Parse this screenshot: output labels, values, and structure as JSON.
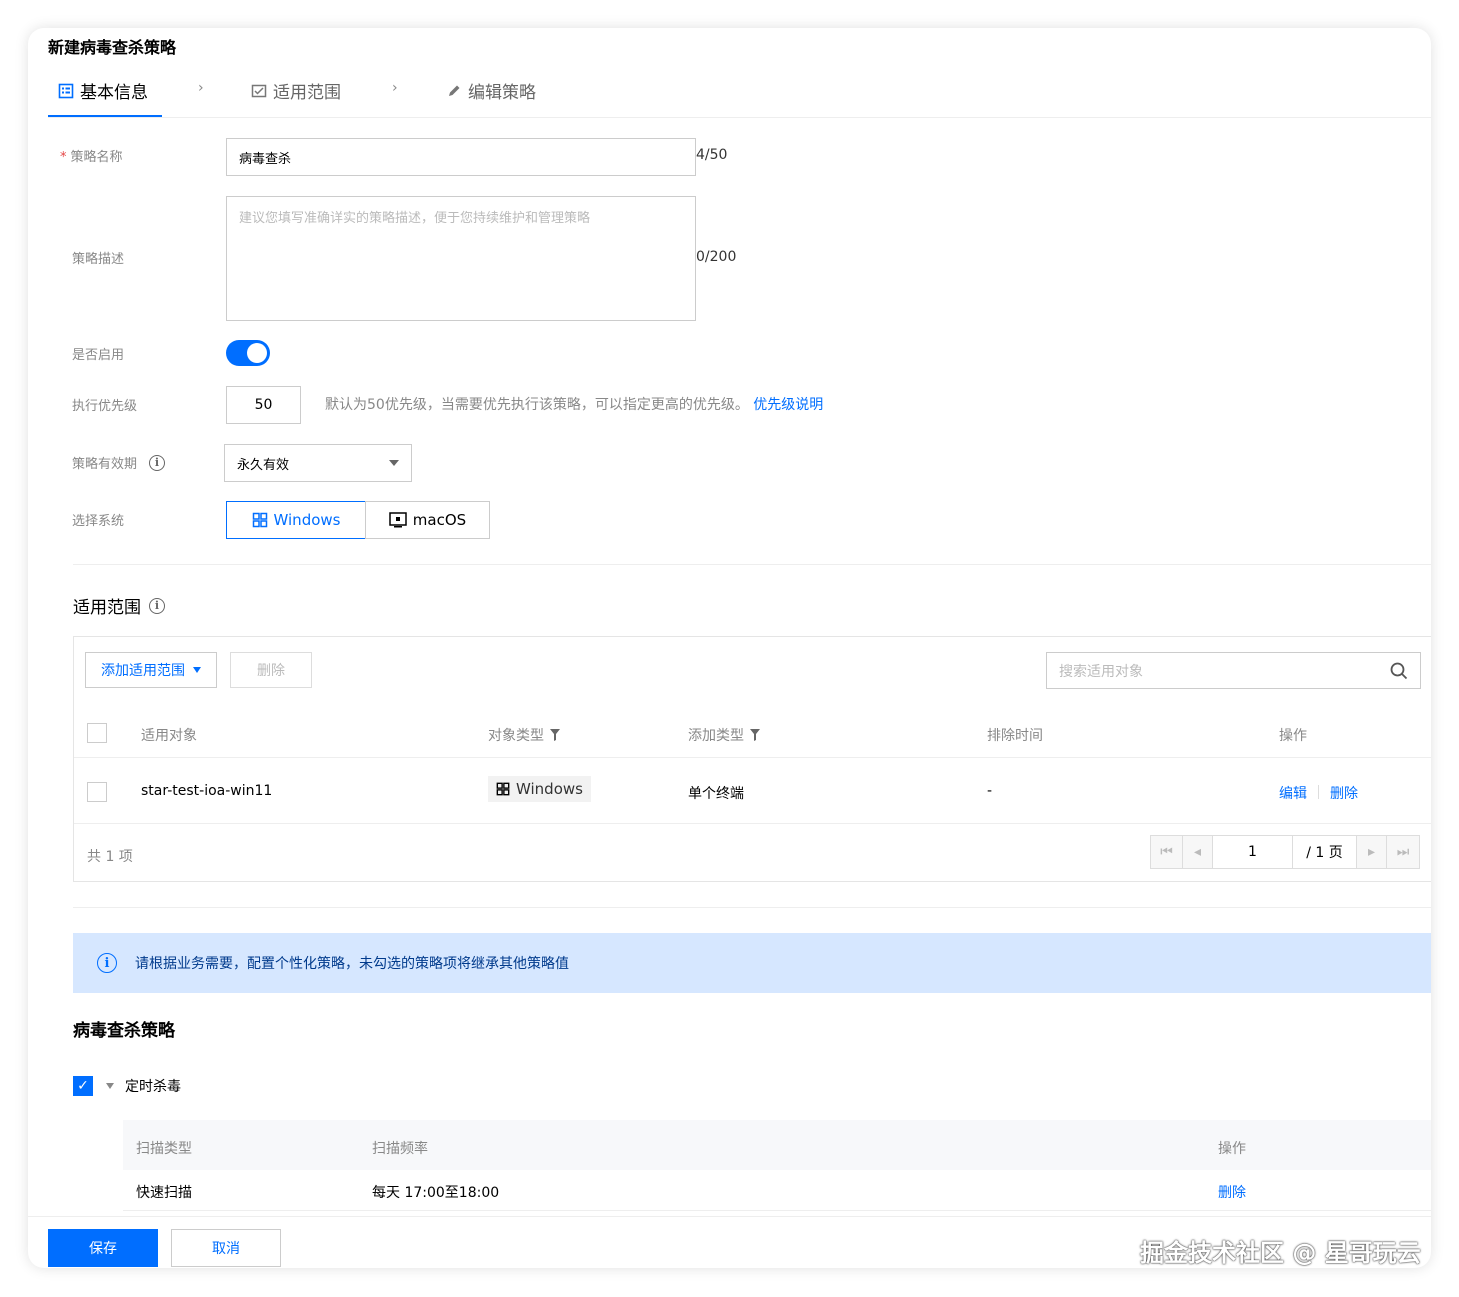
{
  "dialog": {
    "title": "新建病毒查杀策略"
  },
  "steps": [
    {
      "label": "基本信息"
    },
    {
      "label": "适用范围"
    },
    {
      "label": "编辑策略"
    }
  ],
  "form": {
    "name_label": "策略名称",
    "required_mark": "*",
    "name_value": "病毒查杀",
    "name_counter": "4/50",
    "desc_label": "策略描述",
    "desc_placeholder": "建议您填写准确详实的策略描述，便于您持续维护和管理策略",
    "desc_counter": "0/200",
    "enable_label": "是否启用",
    "enabled": true,
    "priority_label": "执行优先级",
    "priority_value": "50",
    "priority_hint": "默认为50优先级，当需要优先执行该策略，可以指定更高的优先级。",
    "priority_link": "优先级说明",
    "validity_label": "策略有效期",
    "validity_value": "永久有效",
    "os_label": "选择系统",
    "os_windows": "Windows",
    "os_mac": "macOS"
  },
  "scope": {
    "title": "适用范围",
    "add_button": "添加适用范围",
    "delete_button": "删除",
    "search_placeholder": "搜索适用对象",
    "columns": {
      "target": "适用对象",
      "type": "对象类型",
      "add_type": "添加类型",
      "exclude_time": "排除时间",
      "action": "操作"
    },
    "rows": [
      {
        "target": "star-test-ioa-win11",
        "type": "Windows",
        "add_type": "单个终端",
        "exclude_time": "-",
        "edit": "编辑",
        "delete": "删除"
      }
    ],
    "total": "共 1 项",
    "page_current": "1",
    "page_total": "/ 1 页"
  },
  "notice": {
    "text": "请根据业务需要，配置个性化策略，未勾选的策略项将继承其他策略值"
  },
  "policy": {
    "title": "病毒查杀策略",
    "scheduled_label": "定时杀毒",
    "columns": {
      "scan_type": "扫描类型",
      "frequency": "扫描频率",
      "action": "操作"
    },
    "rows": [
      {
        "scan_type": "快速扫描",
        "frequency": "每天 17:00至18:00",
        "delete": "删除"
      }
    ]
  },
  "footer": {
    "save": "保存",
    "cancel": "取消"
  },
  "watermark": "掘金技术社区 @ 星哥玩云",
  "colors": {
    "accent": "#006eff",
    "notice_bg": "#d6e7ff",
    "required": "#e54545"
  }
}
